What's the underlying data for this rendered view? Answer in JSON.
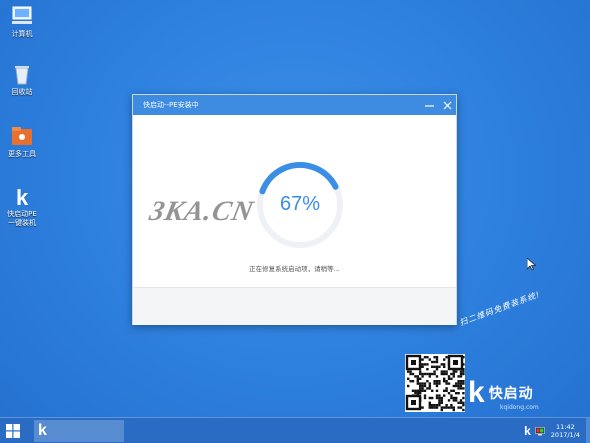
{
  "desktop": {
    "icons": [
      {
        "label": "计算机",
        "icon": "computer-icon"
      },
      {
        "label": "回收站",
        "icon": "recycle-bin-icon"
      },
      {
        "label": "更多工具",
        "icon": "tools-folder-icon"
      },
      {
        "label": "快启动PE一键装机",
        "icon": "kqd-installer-icon"
      }
    ]
  },
  "dialog": {
    "title": "快启动--PE安装中",
    "progress": {
      "percent": 67,
      "label": "67%"
    },
    "status": "正在修复系统启动项，请稍等..."
  },
  "watermark": "3KA.CN",
  "slogan": "扫二维码免费装系统!",
  "brand": {
    "name": "快启动",
    "url": "kqidong.com"
  },
  "taskbar": {
    "time": "11:42",
    "date": "2017/1/4"
  },
  "colors": {
    "accent": "#3e8ce1",
    "progress": "#3a8ee6",
    "taskbar": "#2a6cc4"
  }
}
